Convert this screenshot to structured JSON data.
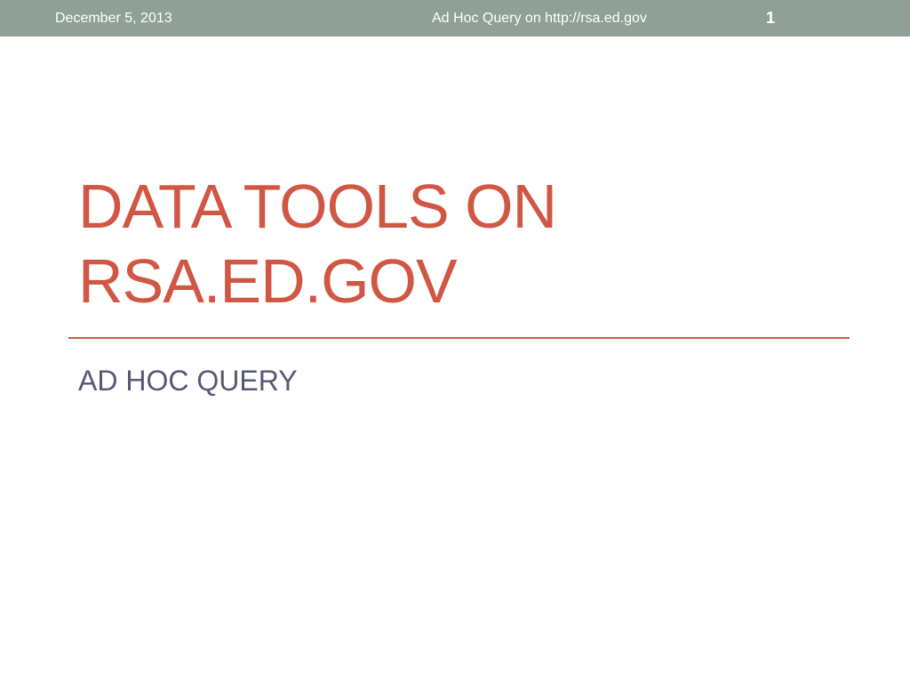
{
  "header": {
    "date": "December 5, 2013",
    "footer_text": "Ad Hoc Query on http://rsa.ed.gov",
    "page_number": "1"
  },
  "slide": {
    "title_lines": [
      "DATA TOOLS ON",
      "RSA.ED.GOV"
    ],
    "subtitle": "AD HOC QUERY"
  },
  "colors": {
    "header_bar": "#8fa097",
    "title": "#d05744",
    "divider": "#d05744",
    "subtitle": "#565874"
  }
}
